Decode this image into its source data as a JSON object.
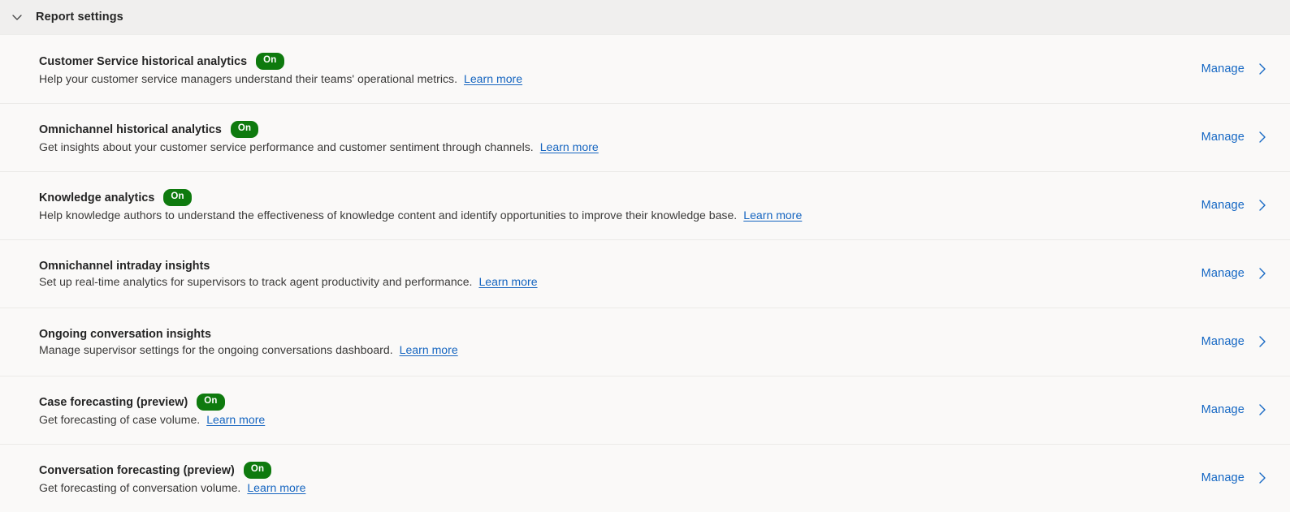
{
  "header": {
    "title": "Report settings",
    "collapse_icon": "chevron-down-icon"
  },
  "colors": {
    "page_background": "#faf9f8",
    "header_background": "#f0efee",
    "divider": "#ebeae8",
    "link": "#1565c0",
    "manage_link": "#1668c4",
    "badge_on_background": "#0e7a0e",
    "badge_on_text": "#ffffff",
    "title_text": "#242424",
    "body_text": "#3b3a39"
  },
  "common": {
    "manage_label": "Manage",
    "manage_icon": "chevron-right-icon",
    "learn_more_label": "Learn more",
    "badge_on_label": "On"
  },
  "rows": [
    {
      "title": "Customer Service historical analytics",
      "badge": "On",
      "description": "Help your customer service managers understand their teams' operational metrics.",
      "learn_more": "Learn more",
      "manage": "Manage"
    },
    {
      "title": "Omnichannel historical analytics",
      "badge": "On",
      "description": "Get insights about your customer service performance and customer sentiment through channels.",
      "learn_more": "Learn more",
      "manage": "Manage"
    },
    {
      "title": "Knowledge analytics",
      "badge": "On",
      "description": "Help knowledge authors to understand the effectiveness of knowledge content and identify opportunities to improve their knowledge base.",
      "learn_more": "Learn more",
      "manage": "Manage"
    },
    {
      "title": "Omnichannel intraday insights",
      "badge": "",
      "description": "Set up real-time analytics for supervisors to track agent productivity and performance.",
      "learn_more": "Learn more",
      "manage": "Manage"
    },
    {
      "title": "Ongoing conversation insights",
      "badge": "",
      "description": "Manage supervisor settings for the ongoing conversations dashboard.",
      "learn_more": "Learn more",
      "manage": "Manage"
    },
    {
      "title": "Case forecasting (preview)",
      "badge": "On",
      "description": "Get forecasting of case volume.",
      "learn_more": "Learn more",
      "manage": "Manage"
    },
    {
      "title": "Conversation forecasting (preview)",
      "badge": "On",
      "description": "Get forecasting of conversation volume.",
      "learn_more": "Learn more",
      "manage": "Manage"
    }
  ]
}
